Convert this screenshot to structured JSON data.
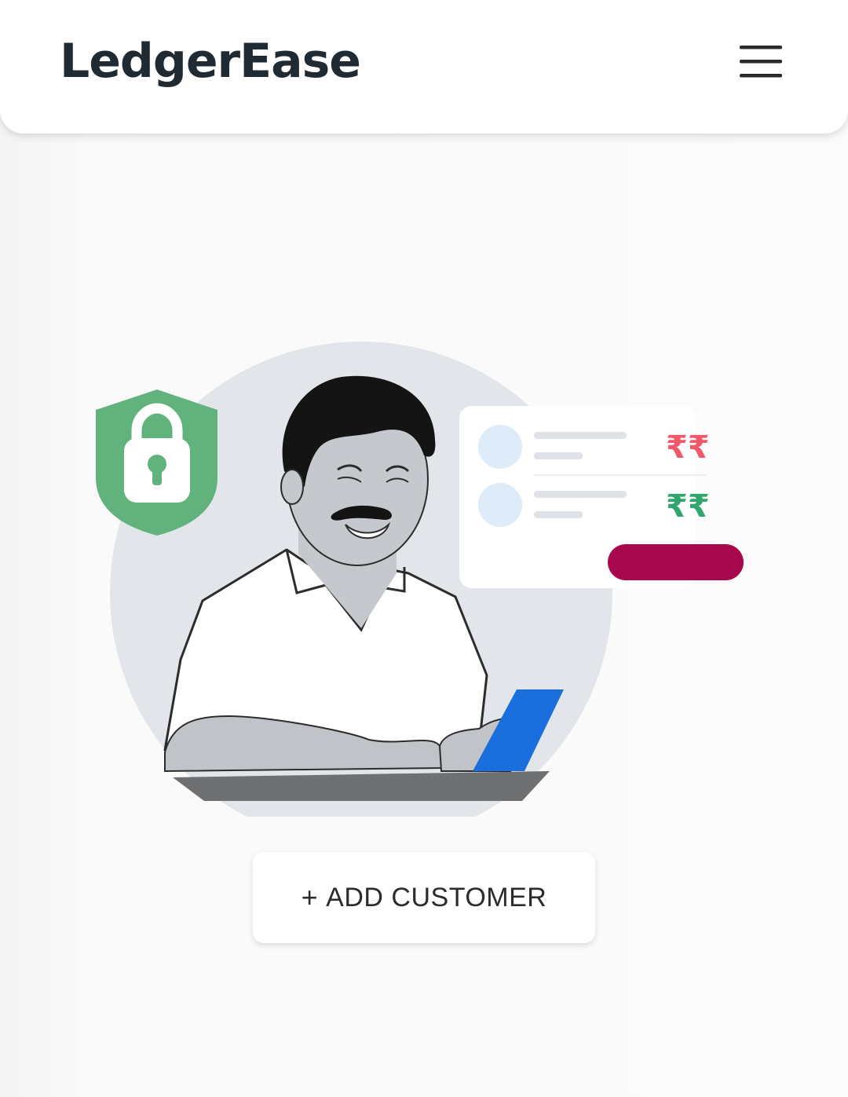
{
  "app_bar": {
    "title": "LedgerEase",
    "menu_icon": "hamburger-menu-icon"
  },
  "illustration": {
    "currency_debit": "₹₹",
    "currency_credit": "₹₹",
    "colors": {
      "shield": "#62b27d",
      "debit": "#ef5a6a",
      "credit": "#2fa66b",
      "pill": "#a8084e",
      "phone": "#1a6fdc"
    }
  },
  "actions": {
    "add_customer_icon": "plus-icon",
    "add_customer_plus": "+",
    "add_customer_label": "ADD CUSTOMER"
  }
}
